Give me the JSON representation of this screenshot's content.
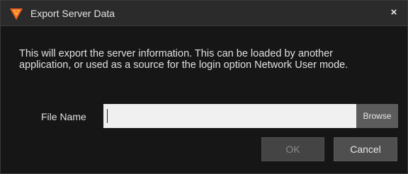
{
  "window": {
    "title": "Export Server Data",
    "app_icon": "app-logo-icon",
    "close_icon": "close-icon",
    "close_glyph": "×"
  },
  "message": "This will export the server information.  This can be loaded by another application, or used as a source for the login option Network User mode.",
  "file_name": {
    "label": "File Name",
    "value": "",
    "placeholder": ""
  },
  "buttons": {
    "browse": "Browse",
    "ok": "OK",
    "cancel": "Cancel"
  },
  "colors": {
    "background": "#161616",
    "titlebar": "#2b2b2b",
    "logo_orange": "#f26522",
    "logo_yellow": "#fbb03b"
  }
}
